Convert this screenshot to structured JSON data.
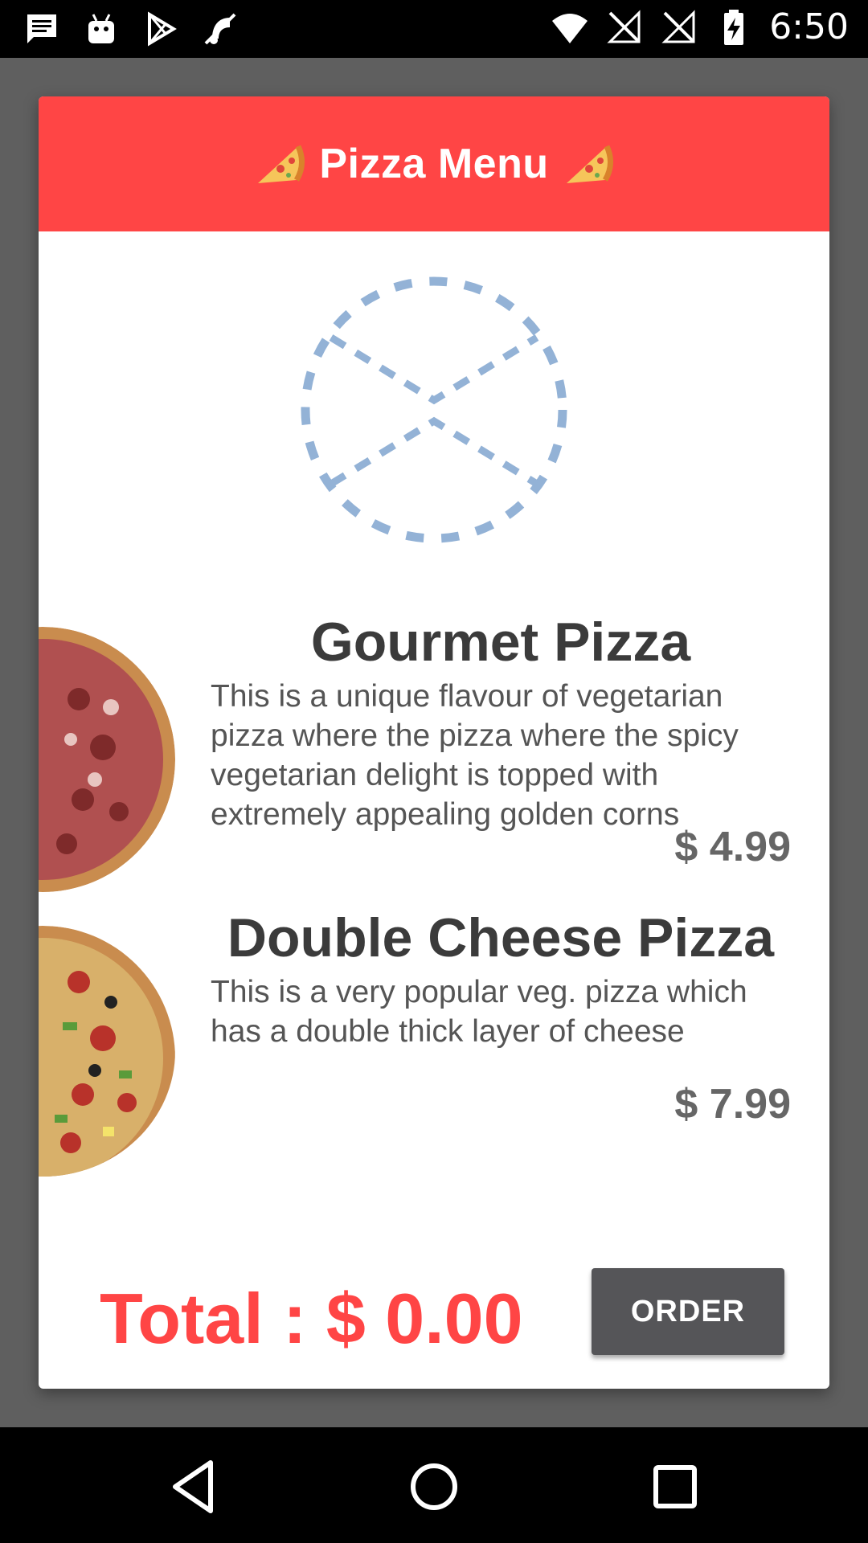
{
  "status_bar": {
    "time": "6:50",
    "left_icons": [
      "message-icon",
      "android-icon",
      "play-store-icon",
      "mute-icon"
    ],
    "right_icons": [
      "wifi-icon",
      "no-signal-icon",
      "no-signal-icon",
      "battery-charging-icon"
    ]
  },
  "header": {
    "title": "Pizza Menu",
    "decoration_icon": "pizza-slice-icon"
  },
  "loader": {
    "icon": "loading-spinner-icon"
  },
  "items": [
    {
      "title": "Gourmet Pizza",
      "description": "This is a unique flavour of vegetarian pizza where the pizza where the spicy vegetarian delight is topped with extremely appealing golden corns",
      "price": "$ 4.99",
      "image": "pepperoni-pizza-image"
    },
    {
      "title": "Double Cheese Pizza",
      "description": "This is a very popular veg. pizza which has a double thick layer of cheese",
      "price": "$ 7.99",
      "image": "supreme-pizza-image"
    }
  ],
  "footer": {
    "total_label": "Total : $ 0.00",
    "order_button": "ORDER"
  },
  "nav_bar": {
    "buttons": [
      "back-icon",
      "home-icon",
      "recents-icon"
    ]
  },
  "colors": {
    "accent": "#ff4545",
    "button": "#555558",
    "loader": "#93b2d6",
    "dim_background": "#5f5f5f"
  }
}
